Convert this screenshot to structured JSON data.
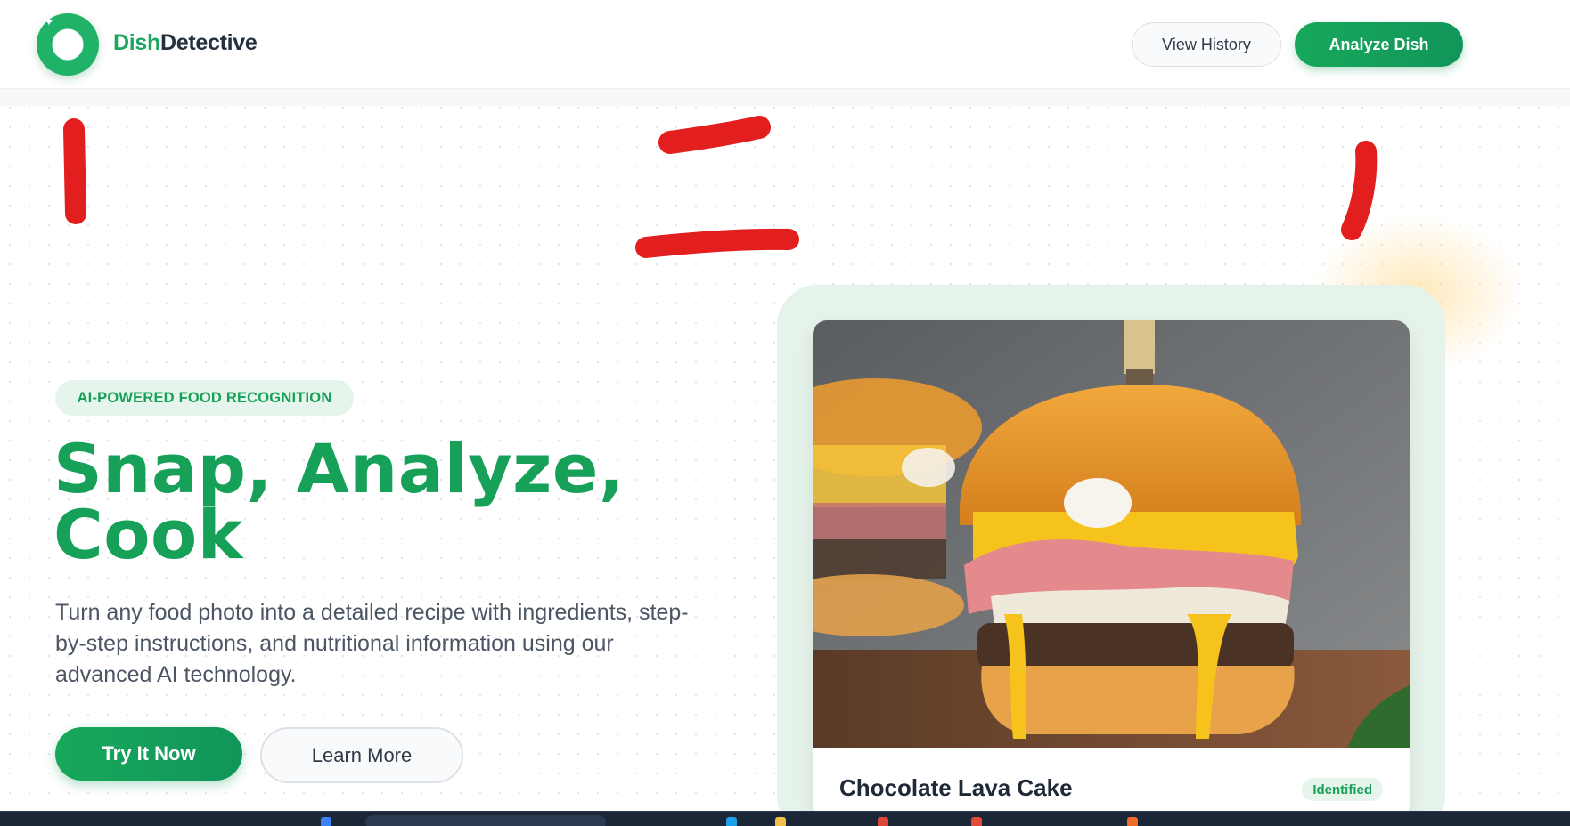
{
  "header": {
    "logo": {
      "text_accent": "Dish",
      "text_main": "Detective",
      "icon": "lens-ring-icon"
    },
    "view_history_label": "View History",
    "analyze_label": "Analyze Dish"
  },
  "hero": {
    "badge": "AI-POWERED FOOD RECOGNITION",
    "headline_line1": "Snap, Analyze,",
    "headline_line2": "Cook",
    "subtext": "Turn any food photo into a detailed recipe with ingredients, step-by-step instructions, and nutritional information using our advanced AI technology.",
    "primary_cta": "Try It Now",
    "secondary_cta": "Learn More"
  },
  "preview_card": {
    "image": "burger-photo",
    "title": "Chocolate Lava Cake",
    "status": "Identified"
  },
  "colors": {
    "brand_green": "#16a058",
    "badge_bg": "#e5f5ec",
    "annotation_red": "#e31e1e"
  }
}
